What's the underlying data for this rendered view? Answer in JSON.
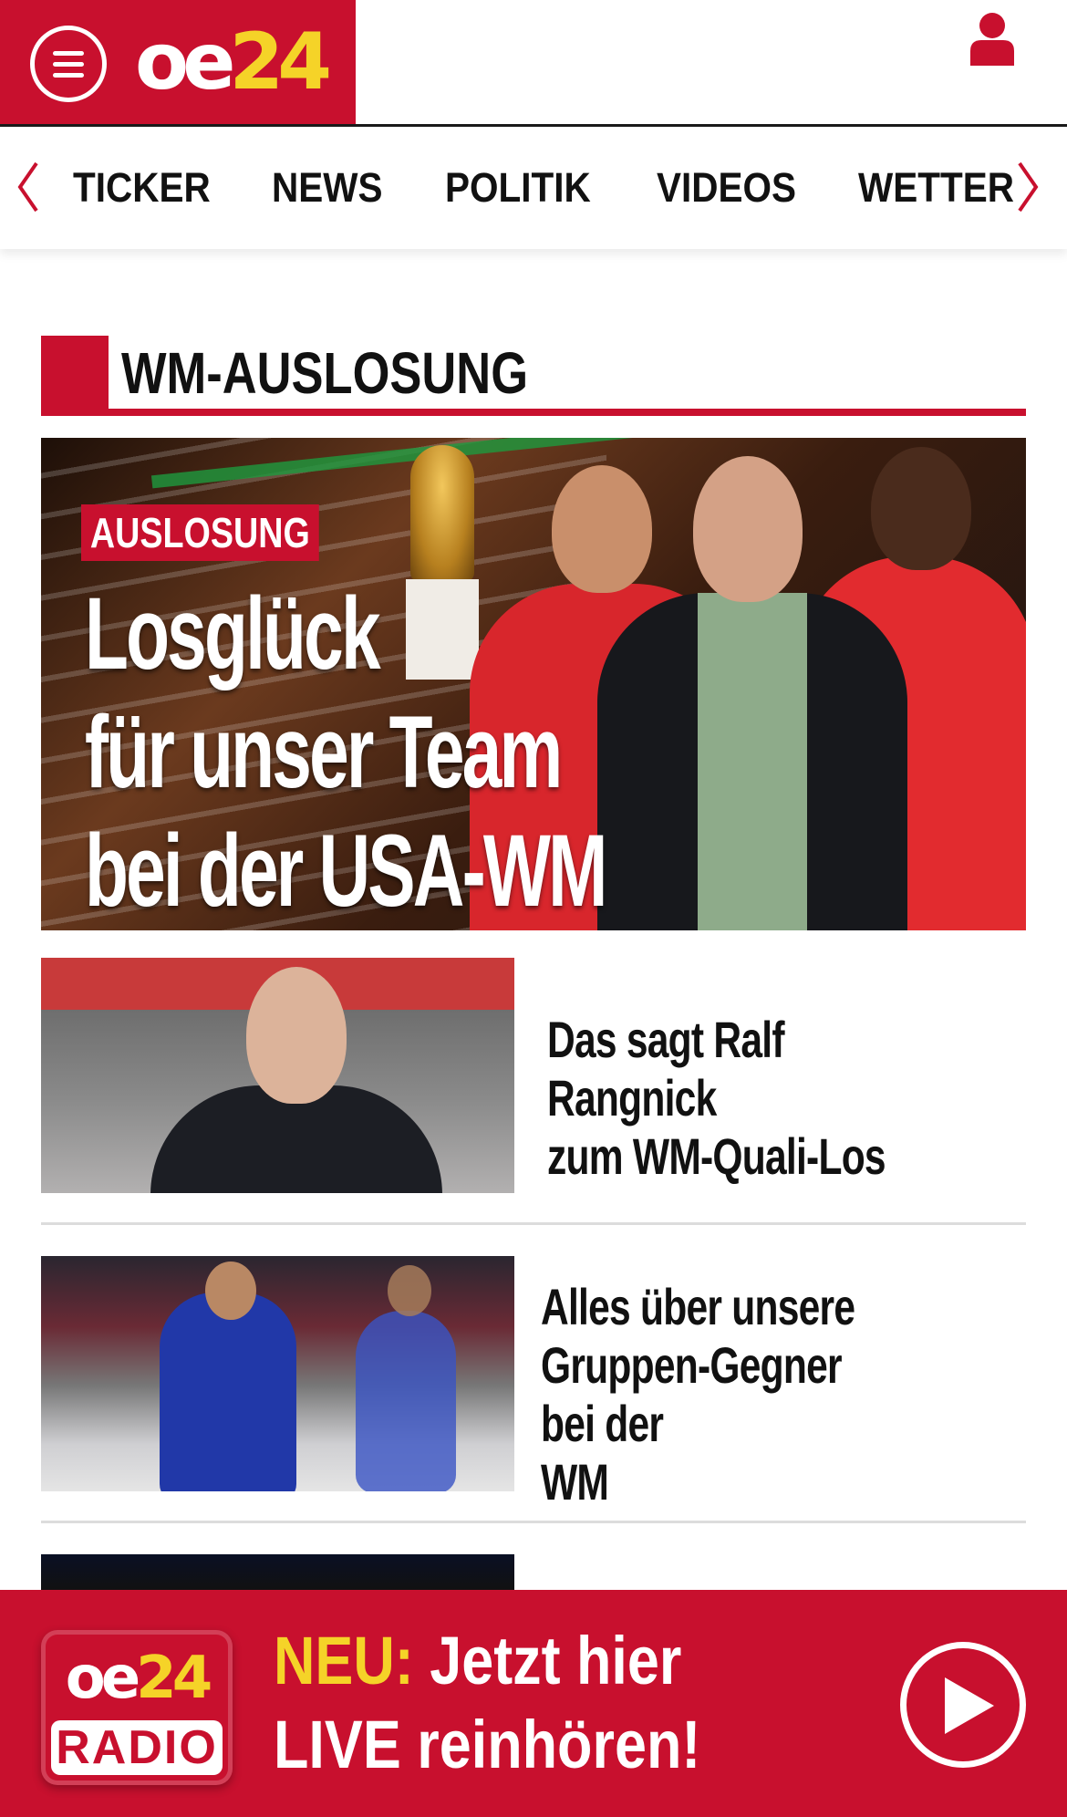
{
  "header": {
    "logo_part1": "oe",
    "logo_part2": "24"
  },
  "nav": {
    "items": [
      "TICKER",
      "NEWS",
      "POLITIK",
      "VIDEOS",
      "WETTER"
    ]
  },
  "section": {
    "title": "WM-AUSLOSUNG"
  },
  "hero": {
    "badge": "AUSLOSUNG",
    "title": "Losglück\nfür unser Team\nbei der USA-WM"
  },
  "articles": [
    {
      "title": "Das sagt Ralf Rangnick\nzum WM-Quali-Los"
    },
    {
      "title": "Alles über unsere\nGruppen-Gegner bei der\nWM"
    }
  ],
  "radio": {
    "logo_part1": "oe",
    "logo_part2": "24",
    "logo_word": "RADIO",
    "neu": "NEU:",
    "line1": " Jetzt hier",
    "line2": "LIVE reinhören!"
  },
  "colors": {
    "brand_red": "#c8102e",
    "brand_yellow": "#f5d328"
  },
  "icons": [
    "menu-icon",
    "user-icon",
    "chevron-left-icon",
    "chevron-right-icon",
    "play-icon"
  ]
}
